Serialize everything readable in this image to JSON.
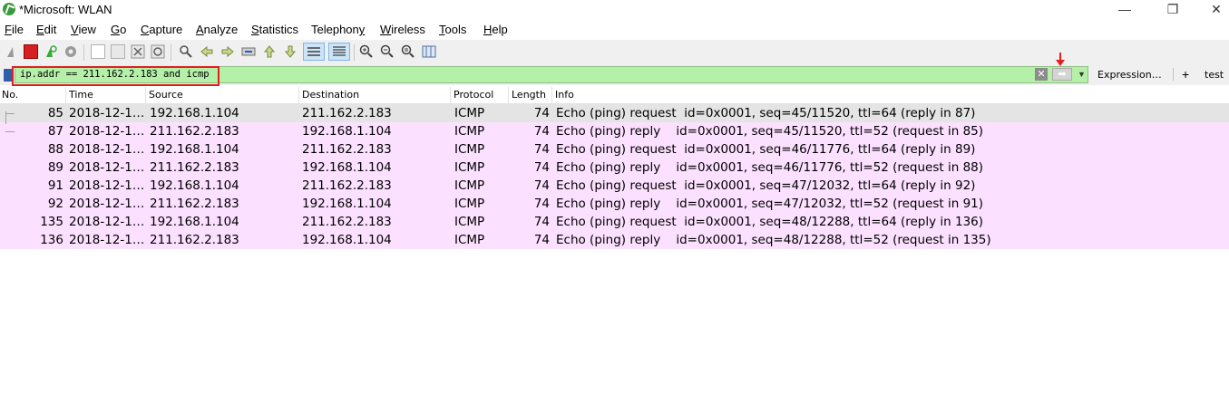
{
  "window": {
    "title": "*Microsoft: WLAN",
    "minimize": "—",
    "maximize": "❐",
    "close": "✕"
  },
  "menu": [
    {
      "label": "File",
      "accel": "F",
      "rest": "ile"
    },
    {
      "label": "Edit",
      "accel": "E",
      "rest": "dit"
    },
    {
      "label": "View",
      "accel": "V",
      "rest": "iew"
    },
    {
      "label": "Go",
      "accel": "G",
      "rest": "o"
    },
    {
      "label": "Capture",
      "accel": "C",
      "rest": "apture"
    },
    {
      "label": "Analyze",
      "accel": "A",
      "rest": "nalyze"
    },
    {
      "label": "Statistics",
      "accel": "S",
      "rest": "tatistics"
    },
    {
      "label": "Telephony",
      "accel": "",
      "rest": "Telephon",
      "tail": "y",
      "tail_ul": true
    },
    {
      "label": "Wireless",
      "accel": "W",
      "rest": "ireless"
    },
    {
      "label": "Tools",
      "accel": "T",
      "rest": "ools"
    },
    {
      "label": "Help",
      "accel": "H",
      "rest": "elp"
    }
  ],
  "filter": {
    "value": "ip.addr == 211.162.2.183 and icmp",
    "expression_label": "Expression…",
    "add_label": "+",
    "button_label": "test"
  },
  "columns": [
    "No.",
    "Time",
    "Source",
    "Destination",
    "Protocol",
    "Length",
    "Info"
  ],
  "packets": [
    {
      "no": "85",
      "time": "2018-12-1…",
      "src": "192.168.1.104",
      "dst": "211.162.2.183",
      "proto": "ICMP",
      "len": "74",
      "info": "Echo (ping) request  id=0x0001, seq=45/11520, ttl=64 (reply in 87)",
      "kind": "selected"
    },
    {
      "no": "87",
      "time": "2018-12-1…",
      "src": "211.162.2.183",
      "dst": "192.168.1.104",
      "proto": "ICMP",
      "len": "74",
      "info": "Echo (ping) reply    id=0x0001, seq=45/11520, ttl=52 (request in 85)",
      "kind": "reply"
    },
    {
      "no": "88",
      "time": "2018-12-1…",
      "src": "192.168.1.104",
      "dst": "211.162.2.183",
      "proto": "ICMP",
      "len": "74",
      "info": "Echo (ping) request  id=0x0001, seq=46/11776, ttl=64 (reply in 89)",
      "kind": "request"
    },
    {
      "no": "89",
      "time": "2018-12-1…",
      "src": "211.162.2.183",
      "dst": "192.168.1.104",
      "proto": "ICMP",
      "len": "74",
      "info": "Echo (ping) reply    id=0x0001, seq=46/11776, ttl=52 (request in 88)",
      "kind": "reply"
    },
    {
      "no": "91",
      "time": "2018-12-1…",
      "src": "192.168.1.104",
      "dst": "211.162.2.183",
      "proto": "ICMP",
      "len": "74",
      "info": "Echo (ping) request  id=0x0001, seq=47/12032, ttl=64 (reply in 92)",
      "kind": "request"
    },
    {
      "no": "92",
      "time": "2018-12-1…",
      "src": "211.162.2.183",
      "dst": "192.168.1.104",
      "proto": "ICMP",
      "len": "74",
      "info": "Echo (ping) reply    id=0x0001, seq=47/12032, ttl=52 (request in 91)",
      "kind": "reply"
    },
    {
      "no": "135",
      "time": "2018-12-1…",
      "src": "192.168.1.104",
      "dst": "211.162.2.183",
      "proto": "ICMP",
      "len": "74",
      "info": "Echo (ping) request  id=0x0001, seq=48/12288, ttl=64 (reply in 136)",
      "kind": "request"
    },
    {
      "no": "136",
      "time": "2018-12-1…",
      "src": "211.162.2.183",
      "dst": "192.168.1.104",
      "proto": "ICMP",
      "len": "74",
      "info": "Echo (ping) reply    id=0x0001, seq=48/12288, ttl=52 (request in 135)",
      "kind": "reply"
    }
  ],
  "colors": {
    "filter_bg": "#b5f0a8",
    "icmp_row": "#fce0ff",
    "selected_row": "#e4e4e4",
    "annotation_red": "#e02020"
  }
}
